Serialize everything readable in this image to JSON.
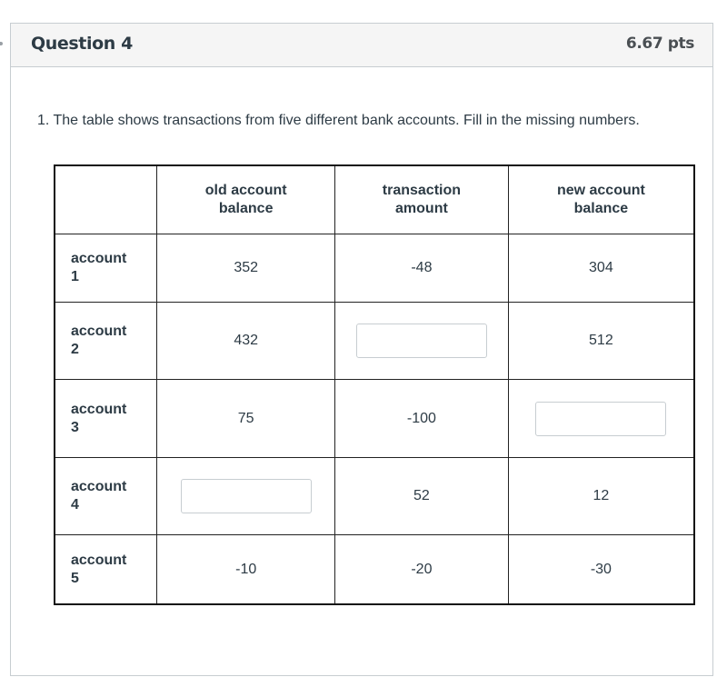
{
  "question": {
    "title": "Question 4",
    "points": "6.67 pts",
    "prompt": "1. The table shows transactions from five different bank accounts. Fill in the missing numbers."
  },
  "table": {
    "headers": [
      "",
      "old account balance",
      "transaction amount",
      "new account balance"
    ],
    "rows": [
      {
        "label_line1": "account",
        "label_line2": "1",
        "old": "352",
        "transaction": "-48",
        "new": "304"
      },
      {
        "label_line1": "account",
        "label_line2": "2",
        "old": "432",
        "transaction": "",
        "new": "512"
      },
      {
        "label_line1": "account",
        "label_line2": "3",
        "old": "75",
        "transaction": "-100",
        "new": ""
      },
      {
        "label_line1": "account",
        "label_line2": "4",
        "old": "",
        "transaction": "52",
        "new": "12"
      },
      {
        "label_line1": "account",
        "label_line2": "5",
        "old": "-10",
        "transaction": "-20",
        "new": "-30"
      }
    ],
    "blank_inputs": [
      {
        "row": 2,
        "column": "transaction amount",
        "value": ""
      },
      {
        "row": 3,
        "column": "new account balance",
        "value": ""
      },
      {
        "row": 4,
        "column": "old account balance",
        "value": ""
      }
    ]
  }
}
